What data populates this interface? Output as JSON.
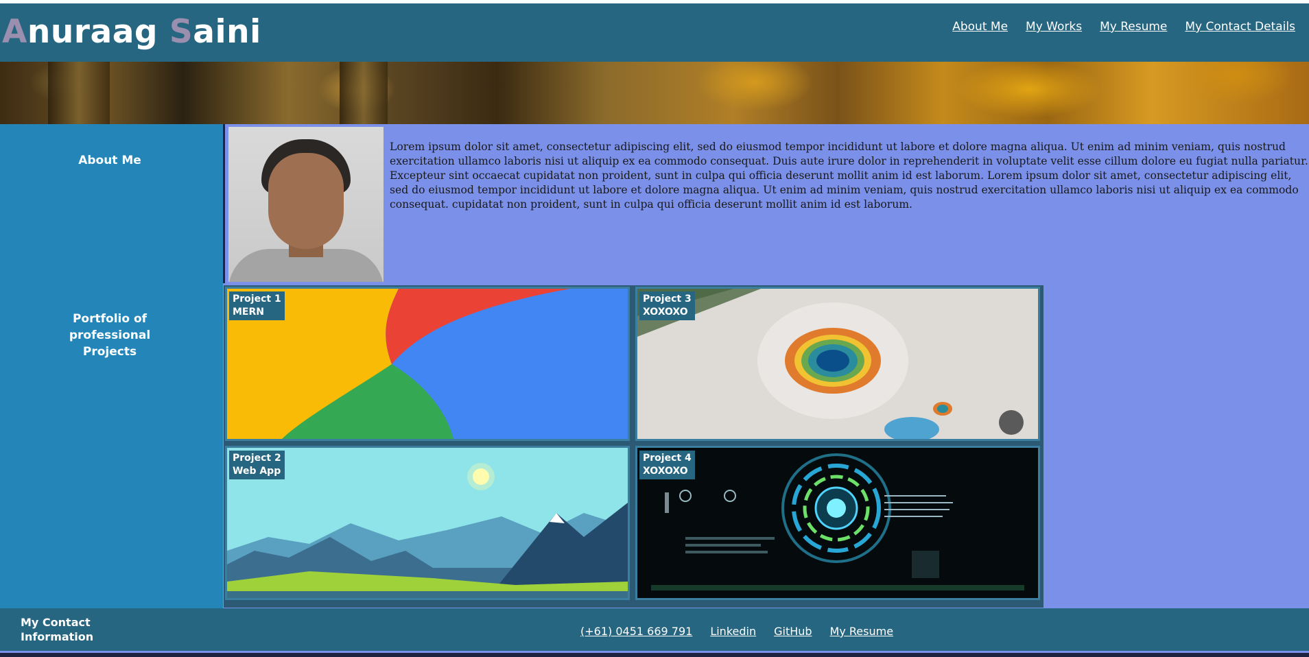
{
  "header": {
    "brand_first_initial": "A",
    "brand_first_rest": "nuraag ",
    "brand_last_initial": "S",
    "brand_last_rest": "aini",
    "nav": [
      "About Me",
      "My Works",
      "My Resume",
      "My Contact Details"
    ]
  },
  "sidebar": {
    "about_label": "About Me",
    "portfolio_label": "Portfolio of professional Projects"
  },
  "about": {
    "text": "Lorem ipsum dolor sit amet, consectetur adipiscing elit, sed do eiusmod tempor incididunt ut labore et dolore magna aliqua. Ut enim ad minim veniam, quis nostrud exercitation ullamco laboris nisi ut aliquip ex ea commodo consequat. Duis aute irure dolor in reprehenderit in voluptate velit esse cillum dolore eu fugiat nulla pariatur. Excepteur sint occaecat cupidatat non proident, sunt in culpa qui officia deserunt mollit anim id est laborum. Lorem ipsum dolor sit amet, consectetur adipiscing elit, sed do eiusmod tempor incididunt ut labore et dolore magna aliqua. Ut enim ad minim veniam, quis nostrud exercitation ullamco laboris nisi ut aliquip ex ea commodo consequat. cupidatat non proident, sunt in culpa qui officia deserunt mollit anim id est laborum."
  },
  "projects": [
    {
      "name": "Project 1",
      "tag": "MERN"
    },
    {
      "name": "Project 3",
      "tag": "XOXOXO"
    },
    {
      "name": "Project 2",
      "tag": "Web App"
    },
    {
      "name": "Project 4",
      "tag": "XOXOXO"
    }
  ],
  "footer": {
    "title_line1": "My Contact",
    "title_line2": "Information",
    "links": [
      "(+61) 0451 669 791",
      "Linkedin",
      "GitHub",
      "My Resume"
    ]
  },
  "colors": {
    "header_bg": "#276680",
    "sidebar_bg": "#2486b8",
    "content_bg": "#7b90e8",
    "brand_accent": "#9b8fb0"
  }
}
